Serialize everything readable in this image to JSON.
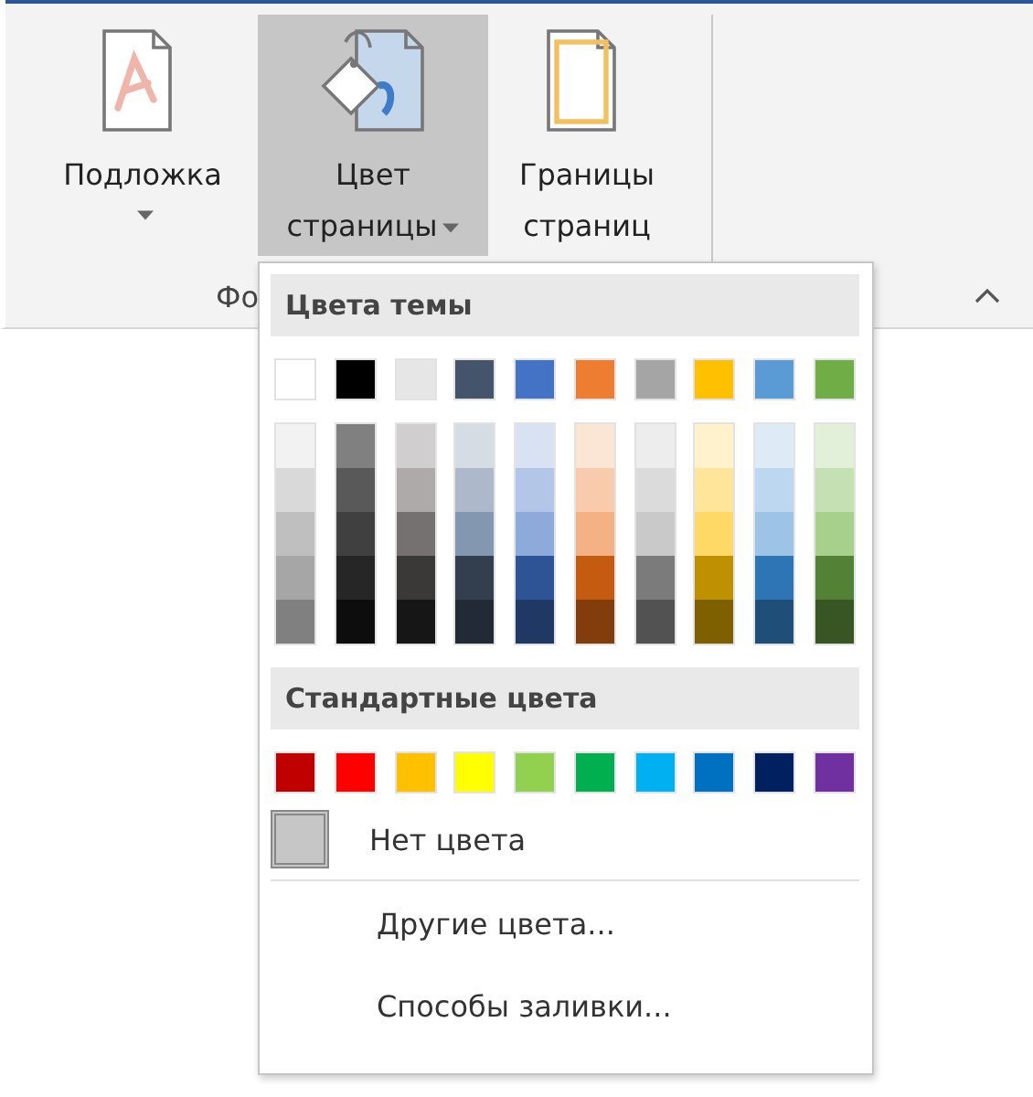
{
  "ribbon": {
    "buttons": [
      {
        "kind": "watermark",
        "label": "Подложка",
        "selected": false,
        "has_dropdown": true
      },
      {
        "kind": "page_color",
        "label": "Цвет страницы",
        "selected": true,
        "has_dropdown": true
      },
      {
        "kind": "page_borders",
        "label": "Границы страниц",
        "selected": false,
        "has_dropdown": false
      }
    ],
    "group_label": "Фо"
  },
  "color_menu": {
    "theme_header": "Цвета темы",
    "theme_colors": [
      {
        "color": "#ffffff",
        "shades": [
          {
            "color": "#f2f2f2"
          },
          {
            "color": "#d9d9d9"
          },
          {
            "color": "#bfbfbf"
          },
          {
            "color": "#a6a6a6"
          },
          {
            "color": "#808080"
          }
        ]
      },
      {
        "color": "#000000",
        "shades": [
          {
            "color": "#808080"
          },
          {
            "color": "#595959"
          },
          {
            "color": "#404040"
          },
          {
            "color": "#262626"
          },
          {
            "color": "#0d0d0d"
          }
        ]
      },
      {
        "color": "#e7e6e6",
        "shades": [
          {
            "color": "#d0cece"
          },
          {
            "color": "#aeaaaa"
          },
          {
            "color": "#757171"
          },
          {
            "color": "#3b3838"
          },
          {
            "color": "#171616"
          }
        ]
      },
      {
        "color": "#44546a",
        "shades": [
          {
            "color": "#d6dce4"
          },
          {
            "color": "#adb9ca"
          },
          {
            "color": "#8497b0"
          },
          {
            "color": "#333f4f"
          },
          {
            "color": "#222a35"
          }
        ]
      },
      {
        "color": "#4472c4",
        "shades": [
          {
            "color": "#d9e2f3"
          },
          {
            "color": "#b4c6e7"
          },
          {
            "color": "#8eaadb"
          },
          {
            "color": "#2f5496"
          },
          {
            "color": "#1f3864"
          }
        ]
      },
      {
        "color": "#ed7d31",
        "shades": [
          {
            "color": "#fbe5d5"
          },
          {
            "color": "#f7cbac"
          },
          {
            "color": "#f4b183"
          },
          {
            "color": "#c55a11"
          },
          {
            "color": "#833c0b"
          }
        ]
      },
      {
        "color": "#a5a5a5",
        "shades": [
          {
            "color": "#ededed"
          },
          {
            "color": "#dbdbdb"
          },
          {
            "color": "#c9c9c9"
          },
          {
            "color": "#7b7b7b"
          },
          {
            "color": "#525252"
          }
        ]
      },
      {
        "color": "#ffc000",
        "shades": [
          {
            "color": "#fff2cc"
          },
          {
            "color": "#ffe599"
          },
          {
            "color": "#ffd966"
          },
          {
            "color": "#bf9000"
          },
          {
            "color": "#7f6000"
          }
        ]
      },
      {
        "color": "#5b9bd5",
        "shades": [
          {
            "color": "#deebf6"
          },
          {
            "color": "#bdd7ee"
          },
          {
            "color": "#9dc3e6"
          },
          {
            "color": "#2e75b5"
          },
          {
            "color": "#1f4e79"
          }
        ]
      },
      {
        "color": "#70ad47",
        "shades": [
          {
            "color": "#e2efd9"
          },
          {
            "color": "#c5e0b3"
          },
          {
            "color": "#a8d08d"
          },
          {
            "color": "#538135"
          },
          {
            "color": "#375623"
          }
        ]
      }
    ],
    "standard_header": "Стандартные цвета",
    "standard_colors": [
      {
        "color": "#c00000"
      },
      {
        "color": "#ff0000"
      },
      {
        "color": "#ffc000"
      },
      {
        "color": "#ffff00"
      },
      {
        "color": "#92d050"
      },
      {
        "color": "#00b050"
      },
      {
        "color": "#00b0f0"
      },
      {
        "color": "#0070c0"
      },
      {
        "color": "#002060"
      },
      {
        "color": "#7030a0"
      }
    ],
    "no_color": "Нет цвета",
    "items": [
      "Другие цвета...",
      "Способы заливки..."
    ]
  }
}
